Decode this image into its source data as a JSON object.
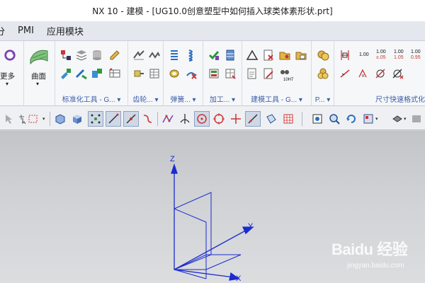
{
  "window": {
    "title": "NX 10 - 建模 - [UG10.0创意塑型中如何插入球类体素形状.prt]"
  },
  "menu": {
    "items": [
      "分",
      "PMI",
      "应用模块"
    ]
  },
  "ribbon": {
    "left_big": {
      "more_label": "更多",
      "surface_label": "曲面"
    },
    "groups": [
      {
        "label": "标准化工具 - G...",
        "dropdown": "▾"
      },
      {
        "label": "齿轮...",
        "dropdown": "▾"
      },
      {
        "label": "弹簧...",
        "dropdown": "▾"
      },
      {
        "label": "加工...",
        "dropdown": "▾"
      },
      {
        "label": "建模工具 - G...",
        "dropdown": "▾"
      },
      {
        "label": "P...",
        "dropdown": "▾"
      },
      {
        "label": "尺寸快速格式化",
        "dropdown": ""
      }
    ],
    "dim_values": {
      "d1": "1.00",
      "d2_top": "1.00",
      "d2_bot": "±.05",
      "d3_top": "1.00",
      "d3_bot": "1.05",
      "d4_top": "1.00",
      "d4_bot": "0.95",
      "tol_label": "10H7"
    }
  },
  "viewport": {
    "axes": {
      "z": "Z",
      "y": "Y",
      "x": "X"
    },
    "axis_color": "#1a2bd0"
  },
  "watermark": {
    "logo": "Baidu 经验",
    "url": "jingyan.baidu.com"
  }
}
